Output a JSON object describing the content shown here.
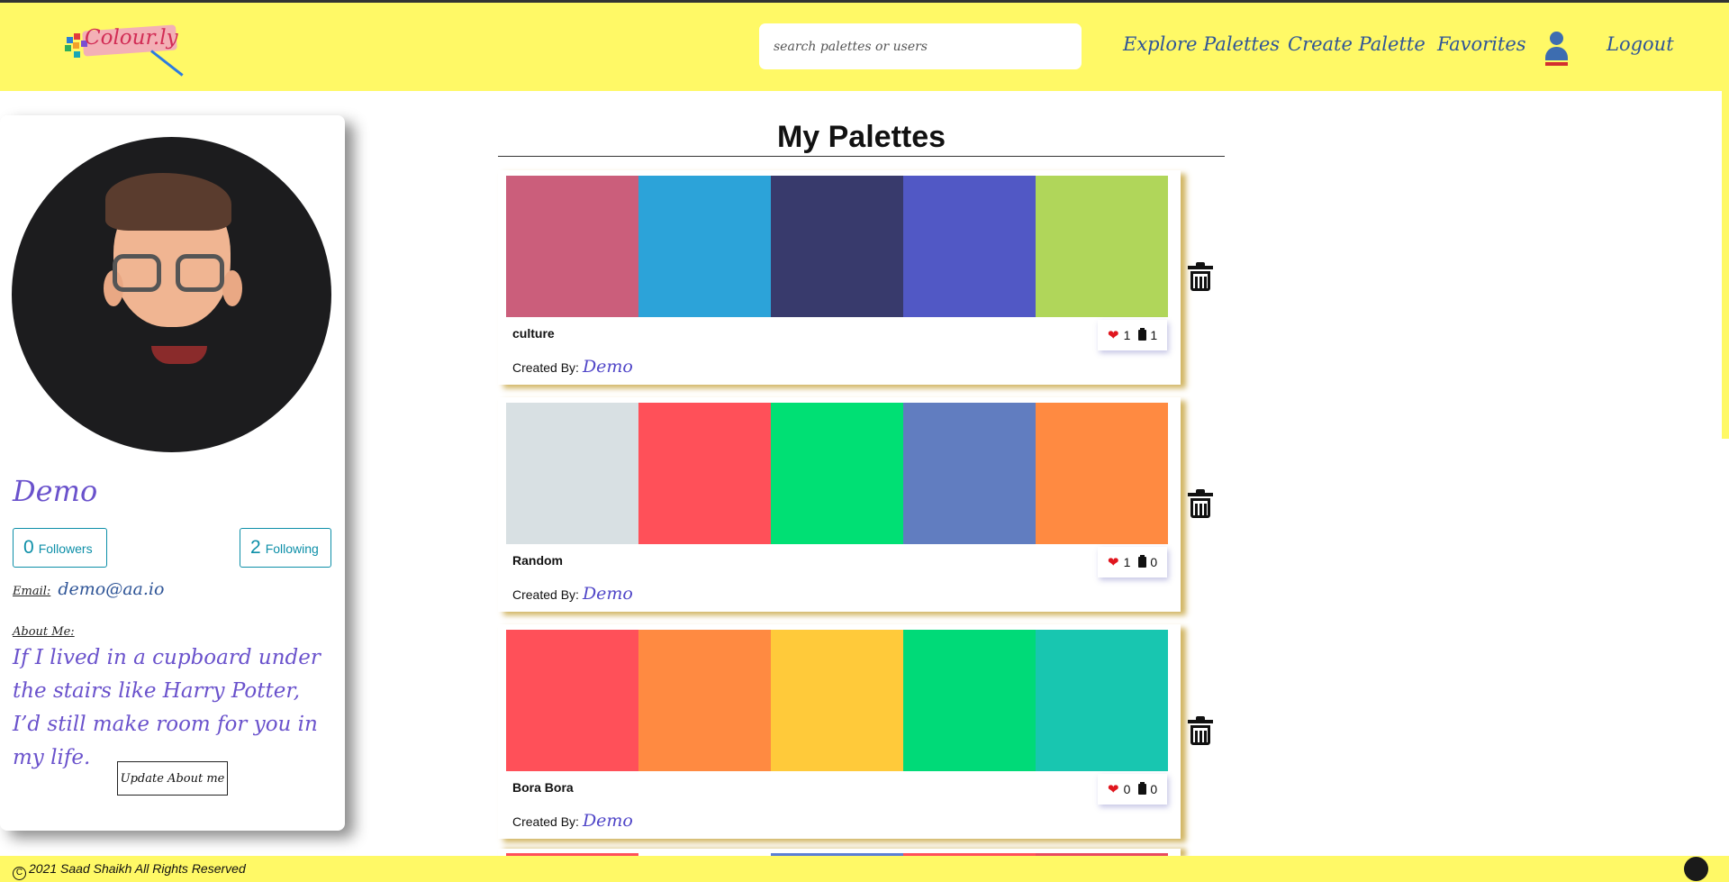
{
  "header": {
    "logo_text": "Colour.ly",
    "search_placeholder": "search palettes or users",
    "nav": [
      "Explore Palettes",
      "Create Palette",
      "Favorites",
      "Logout"
    ],
    "colors": {
      "bar": "#fff966",
      "link": "#2f5597"
    }
  },
  "profile": {
    "name": "Demo",
    "followers": {
      "count": "0",
      "label": "Followers"
    },
    "following": {
      "count": "2",
      "label": "Following"
    },
    "email_label": "Email:",
    "email": "demo@aa.io",
    "about_label": "About Me:",
    "about": "If I lived in a cupboard under the stairs like Harry Potter, I’d still make room for you in my life.",
    "update_button": "Update About me"
  },
  "main": {
    "title": "My Palettes",
    "created_by_label": "Created By:",
    "palettes": [
      {
        "name": "culture",
        "likes": "1",
        "saves": "1",
        "creator": "Demo",
        "colors": [
          "#cb5e7b",
          "#2ca3d9",
          "#383a6c",
          "#5158c5",
          "#b0d65a"
        ]
      },
      {
        "name": "Random",
        "likes": "1",
        "saves": "0",
        "creator": "Demo",
        "colors": [
          "#d8e0e3",
          "#ff5059",
          "#00e074",
          "#617dc0",
          "#ff8a41"
        ]
      },
      {
        "name": "Bora Bora",
        "likes": "0",
        "saves": "0",
        "creator": "Demo",
        "colors": [
          "#ff5059",
          "#ff8a41",
          "#ffca3a",
          "#00da78",
          "#18c6b0"
        ]
      }
    ],
    "partial_palette_colors": [
      "#ff5059",
      "#ffffff",
      "#5b7fd4",
      "#ff5059",
      "#e84a5f"
    ]
  },
  "footer": {
    "copyright": "2021 Saad Shaikh All Rights Reserved",
    "github_icon": "github-icon"
  }
}
